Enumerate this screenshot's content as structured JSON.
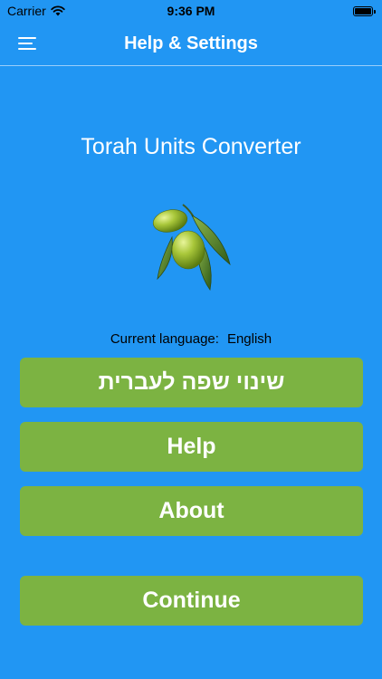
{
  "status": {
    "carrier": "Carrier",
    "time": "9:36 PM"
  },
  "nav": {
    "title": "Help & Settings",
    "menu_icon": "hamburger-menu-icon"
  },
  "app": {
    "title": "Torah Units Converter",
    "logo_icon": "olive-branch-icon"
  },
  "language": {
    "label": "Current language:",
    "value": "English"
  },
  "buttons": {
    "change_language": "שינוי שפה לעברית",
    "help": "Help",
    "about": "About",
    "continue": "Continue"
  },
  "colors": {
    "background": "#2196f3",
    "button": "#7cb342",
    "text": "#ffffff"
  }
}
